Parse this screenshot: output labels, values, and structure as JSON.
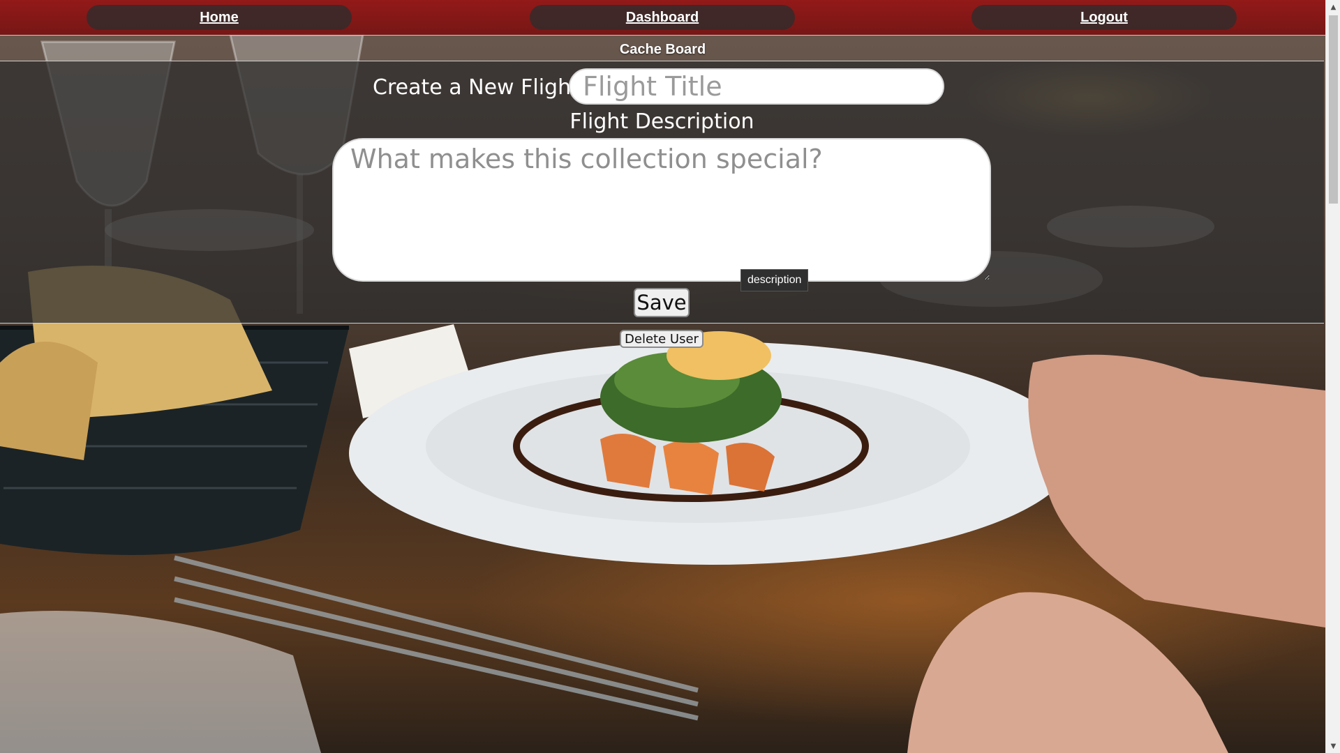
{
  "nav": {
    "home": "Home",
    "dashboard": "Dashboard",
    "logout": "Logout"
  },
  "page": {
    "subtitle": "Cache Board"
  },
  "form": {
    "create_label": "Create a New Flight",
    "title_placeholder": "Flight Title",
    "title_value": "",
    "description_label": "Flight Description",
    "description_placeholder": "What makes this collection special?",
    "description_value": "",
    "tooltip": "description",
    "save_label": "Save"
  },
  "actions": {
    "delete_user_label": "Delete User"
  },
  "scrollbar": {
    "up_icon": "scroll-up-arrow",
    "down_icon": "scroll-down-arrow"
  },
  "colors": {
    "navbar": "#8c1111",
    "nav_pill": "#2d2d2d",
    "panel": "#2d2d2d",
    "text_light": "#ffffff"
  }
}
